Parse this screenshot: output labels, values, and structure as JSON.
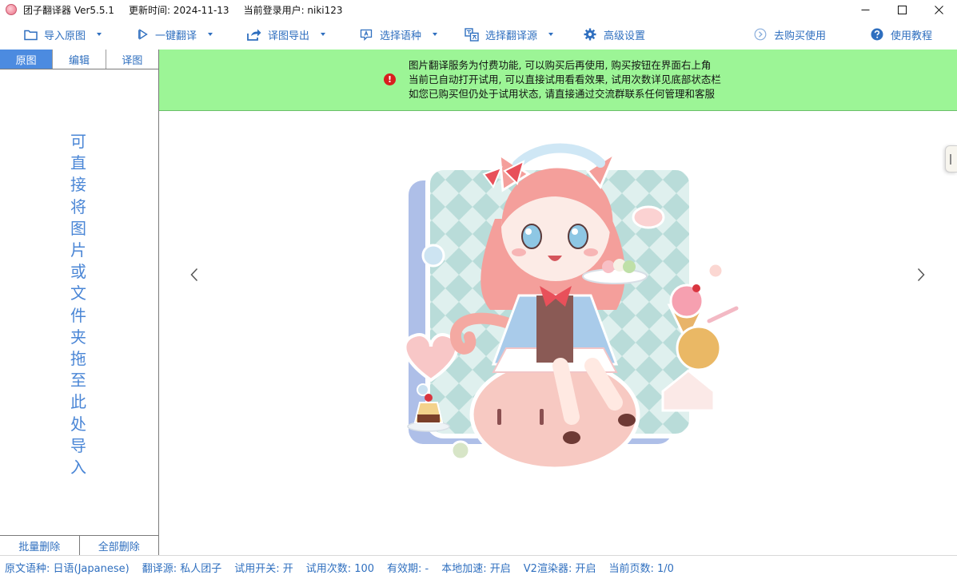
{
  "titlebar": {
    "app_name": "团子翻译器 Ver5.5.1",
    "update_time": "更新时间: 2024-11-13",
    "login_user": "当前登录用户: niki123"
  },
  "toolbar": {
    "import": "导入原图",
    "one_click_translate": "一键翻译",
    "export": "译图导出",
    "select_language": "选择语种",
    "select_source": "选择翻译源",
    "advanced_settings": "高级设置",
    "buy": "去购买使用",
    "tutorial": "使用教程"
  },
  "left_panel": {
    "tabs": [
      "原图",
      "编辑",
      "译图"
    ],
    "drop_hint": [
      "可",
      "直",
      "接",
      "将",
      "图",
      "片",
      "或",
      "文",
      "件",
      "夹",
      "拖",
      "至",
      "此",
      "处",
      "导",
      "入"
    ],
    "batch_delete": "批量删除",
    "delete_all": "全部删除"
  },
  "notice": {
    "lines": [
      "图片翻译服务为付费功能, 可以购买后再使用, 购买按钮在界面右上角",
      "当前已自动打开试用, 可以直接试用看看效果, 试用次数详见底部状态栏",
      "如您已购买但仍处于试用状态, 请直接通过交流群联系任何管理和客服"
    ],
    "icon_glyph": "!"
  },
  "statusbar": {
    "source_lang": "原文语种:  日语(Japanese)",
    "trans_source": "翻译源:  私人团子",
    "trial_switch": "试用开关:  开",
    "trial_count": "试用次数:  100",
    "validity": "有效期:  -",
    "local_accel": "本地加速:  开启",
    "v2_renderer": "V2渲染器:  开启",
    "page": "当前页数:  1/0"
  },
  "colors": {
    "accent": "#2f6fbf",
    "tab_active": "#4c8be0",
    "notice_bg": "#9cf596",
    "notice_icon": "#d81e1e",
    "drop_hint": "#4a86d6"
  }
}
